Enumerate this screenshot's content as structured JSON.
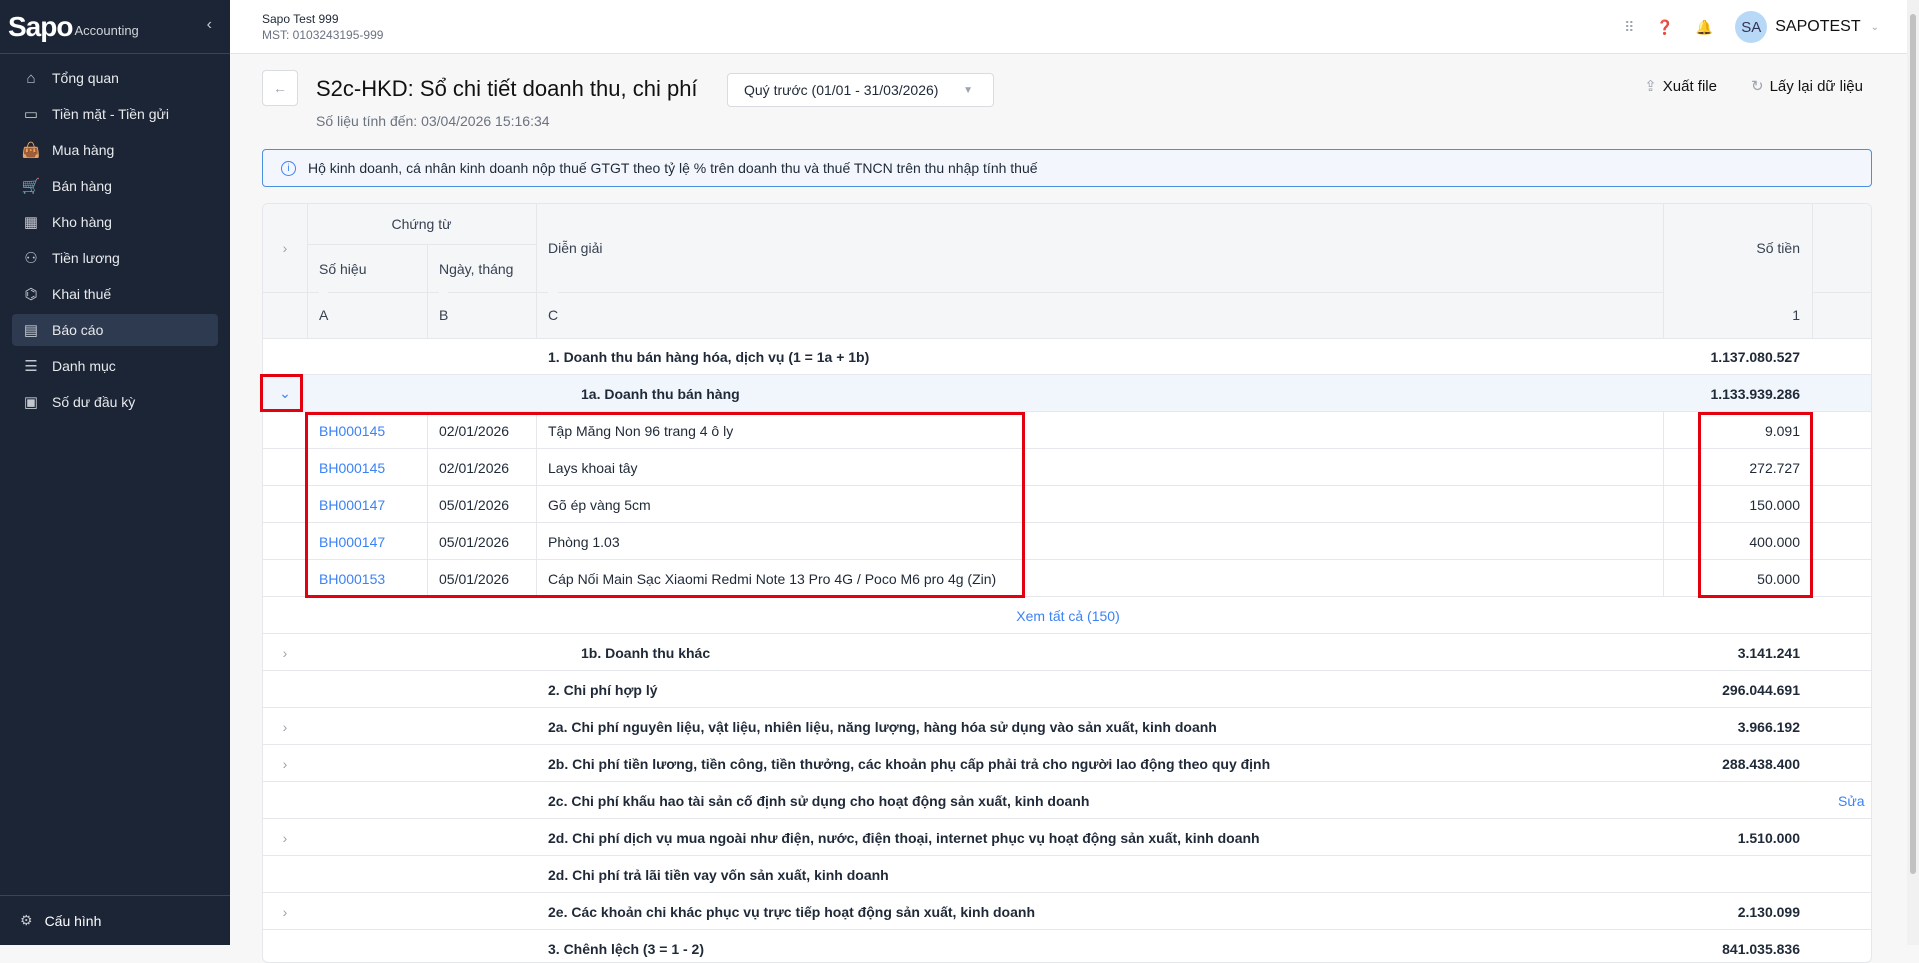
{
  "sidebar": {
    "logo": "Sapo",
    "logo_sub": "Accounting",
    "items": [
      {
        "label": "Tổng quan",
        "icon": "home-icon",
        "glyph": "⌂"
      },
      {
        "label": "Tiền mặt - Tiền gửi",
        "icon": "cash-icon",
        "glyph": "▭"
      },
      {
        "label": "Mua hàng",
        "icon": "bag-icon",
        "glyph": "👜"
      },
      {
        "label": "Bán hàng",
        "icon": "cart-icon",
        "glyph": "🛒"
      },
      {
        "label": "Kho hàng",
        "icon": "warehouse-icon",
        "glyph": "▦"
      },
      {
        "label": "Tiền lương",
        "icon": "salary-icon",
        "glyph": "⚇"
      },
      {
        "label": "Khai thuế",
        "icon": "bank-icon",
        "glyph": "⌬"
      },
      {
        "label": "Báo cáo",
        "icon": "report-icon",
        "glyph": "▤"
      },
      {
        "label": "Danh mục",
        "icon": "list-icon",
        "glyph": "☰"
      },
      {
        "label": "Số dư đầu kỳ",
        "icon": "balance-icon",
        "glyph": "▣"
      }
    ],
    "settings": "Cấu hình"
  },
  "header": {
    "org_name": "Sapo Test 999",
    "tax_code": "MST: 0103243195-999",
    "avatar": "SA",
    "user": "SAPOTEST"
  },
  "page": {
    "title": "S2c-HKD: Sổ chi tiết doanh thu, chi phí",
    "period": "Quý trước (01/01 - 31/03/2026)",
    "updated": "Số liệu tính đến: 03/04/2026 15:16:34",
    "export": "Xuất file",
    "reload": "Lấy lại dữ liệu",
    "info": "Hộ kinh doanh, cá nhân kinh doanh nộp thuế GTGT theo tỷ lệ % trên doanh thu và thuế TNCN trên thu nhập tính thuế"
  },
  "table": {
    "headers": {
      "voucher": "Chứng từ",
      "number": "Số hiệu",
      "date": "Ngày, tháng",
      "desc": "Diễn giải",
      "amount": "Số tiền",
      "col_a": "A",
      "col_b": "B",
      "col_c": "C",
      "col_1": "1"
    },
    "rows": [
      {
        "type": "group",
        "expand": "none",
        "label": "1. Doanh thu bán hàng hóa, dịch vụ (1 = 1a + 1b)",
        "amount": "1.137.080.527"
      },
      {
        "type": "sub",
        "expand": "open",
        "label": "1a. Doanh thu bán hàng",
        "amount": "1.133.939.286"
      },
      {
        "type": "detail",
        "number": "BH000145",
        "date": "02/01/2026",
        "label": "Tập Măng Non 96 trang 4 ô ly",
        "amount": "9.091"
      },
      {
        "type": "detail",
        "number": "BH000145",
        "date": "02/01/2026",
        "label": "Lays khoai tây",
        "amount": "272.727"
      },
      {
        "type": "detail",
        "number": "BH000147",
        "date": "05/01/2026",
        "label": "Gõ ép vàng 5cm",
        "amount": "150.000"
      },
      {
        "type": "detail",
        "number": "BH000147",
        "date": "05/01/2026",
        "label": "Phòng 1.03",
        "amount": "400.000"
      },
      {
        "type": "detail",
        "number": "BH000153",
        "date": "05/01/2026",
        "label": "Cáp Nối Main Sạc Xiaomi Redmi Note 13 Pro 4G / Poco M6 pro 4g (Zin)",
        "amount": "50.000"
      },
      {
        "type": "more",
        "label": "Xem tất cả (150)"
      },
      {
        "type": "sub",
        "expand": "closed",
        "label": "1b. Doanh thu khác",
        "amount": "3.141.241"
      },
      {
        "type": "group",
        "expand": "none",
        "label": "2. Chi phí hợp lý",
        "amount": "296.044.691"
      },
      {
        "type": "group",
        "expand": "closed",
        "label": "2a. Chi phí nguyên liệu, vật liệu, nhiên liệu, năng lượng, hàng hóa sử dụng vào sản xuất, kinh doanh",
        "amount": "3.966.192"
      },
      {
        "type": "group",
        "expand": "closed",
        "label": "2b. Chi phí tiền lương, tiền công, tiền thưởng, các khoản phụ cấp phải trả cho người lao động theo quy định",
        "amount": "288.438.400"
      },
      {
        "type": "group",
        "expand": "none",
        "label": "2c. Chi phí khấu hao tài sản cố định sử dụng cho hoạt động sản xuất, kinh doanh",
        "amount": "",
        "action": "Sửa"
      },
      {
        "type": "group",
        "expand": "closed",
        "label": "2d. Chi phí dịch vụ mua ngoài như điện, nước, điện thoại, internet phục vụ hoạt động sản xuất, kinh doanh",
        "amount": "1.510.000"
      },
      {
        "type": "group",
        "expand": "none",
        "label": "2d. Chi phí trả lãi tiền vay vốn sản xuất, kinh doanh",
        "amount": ""
      },
      {
        "type": "group",
        "expand": "closed",
        "label": "2e. Các khoản chi khác phục vụ trực tiếp hoạt động sản xuất, kinh doanh",
        "amount": "2.130.099"
      },
      {
        "type": "group",
        "expand": "none",
        "label": "3. Chênh lệch (3 = 1 - 2)",
        "amount": "841.035.836"
      }
    ]
  }
}
